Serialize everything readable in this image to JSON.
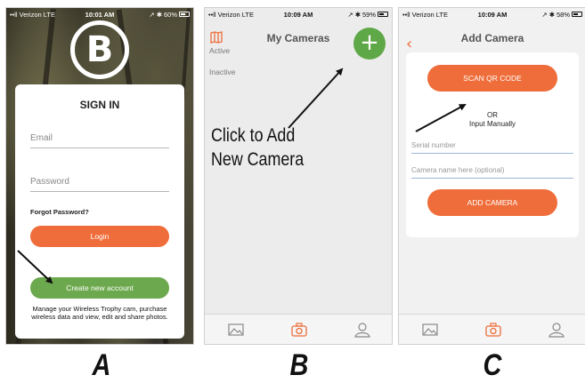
{
  "screens": {
    "a": {
      "status": {
        "carrier": "••ll Verizon  LTE",
        "time": "10:01 AM",
        "battery": "60%",
        "battery_level": 0.6
      },
      "logo_letter": "B",
      "title": "SIGN IN",
      "email_placeholder": "Email",
      "password_placeholder": "Password",
      "forgot_password": "Forgot Password?",
      "login_button": "Login",
      "create_account_button": "Create new account",
      "blurb": "Manage your Wireless Trophy cam, purchase wireless data and view, edit and share photos."
    },
    "b": {
      "status": {
        "carrier": "••ll Verizon  LTE",
        "time": "10:09 AM",
        "battery": "59%",
        "battery_level": 0.59
      },
      "title": "My Cameras",
      "sections": [
        "Active",
        "Inactive"
      ],
      "add_icon": "plus-icon",
      "tabs": [
        "image-icon",
        "camera-icon",
        "user-icon"
      ]
    },
    "c": {
      "status": {
        "carrier": "••ll Verizon  LTE",
        "time": "10:09 AM",
        "battery": "58%",
        "battery_level": 0.58
      },
      "title": "Add Camera",
      "scan_button": "SCAN QR CODE",
      "or_label": "OR",
      "input_manually": "Input Manually",
      "serial_placeholder": "Serial number",
      "name_placeholder": "Camera name here (optional)",
      "add_button": "ADD CAMERA",
      "tabs": [
        "image-icon",
        "camera-icon",
        "user-icon"
      ]
    }
  },
  "callout": {
    "line1": "Click to Add",
    "line2": "New Camera"
  },
  "captions": [
    "A",
    "B",
    "C"
  ],
  "colors": {
    "accent_orange": "#ee6d3a",
    "accent_green": "#6ca84d",
    "active_tab": "#ee6d3a"
  }
}
